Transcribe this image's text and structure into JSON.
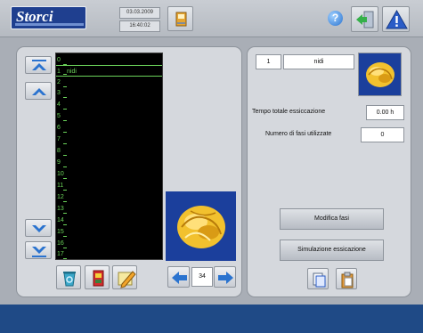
{
  "header": {
    "logo_text": "Storci",
    "date": "03.03.2009",
    "time": "16:40:02"
  },
  "phase_list": {
    "rows": [
      {
        "num": "0",
        "name": ""
      },
      {
        "num": "1",
        "name": "nidi"
      },
      {
        "num": "2",
        "name": ""
      },
      {
        "num": "3",
        "name": ""
      },
      {
        "num": "4",
        "name": ""
      },
      {
        "num": "5",
        "name": ""
      },
      {
        "num": "6",
        "name": ""
      },
      {
        "num": "7",
        "name": ""
      },
      {
        "num": "8",
        "name": ""
      },
      {
        "num": "9",
        "name": ""
      },
      {
        "num": "10",
        "name": ""
      },
      {
        "num": "11",
        "name": ""
      },
      {
        "num": "12",
        "name": ""
      },
      {
        "num": "13",
        "name": ""
      },
      {
        "num": "14",
        "name": ""
      },
      {
        "num": "15",
        "name": ""
      },
      {
        "num": "16",
        "name": ""
      },
      {
        "num": "17",
        "name": ""
      }
    ],
    "selected_index": 1
  },
  "pager": {
    "page": "34"
  },
  "recipe": {
    "number": "1",
    "name": "nidi",
    "total_time_label": "Tempo totale essiccazione",
    "total_time_value": "0.00 h",
    "phases_label": "Numero di fasi utilizzate",
    "phases_value": "0"
  },
  "actions": {
    "modifica_label": "Modifica fasi",
    "simulazione_label": "Simulazione essicazione"
  },
  "colors": {
    "accent_blue": "#1f4a86",
    "list_text": "#6bd35a",
    "preview_bg": "#1b3f9c"
  }
}
